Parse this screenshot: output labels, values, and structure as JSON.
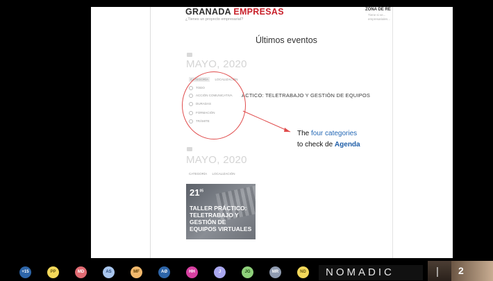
{
  "header": {
    "brand_part1": "GRANADA",
    "brand_part2": "EMPRESAS",
    "tagline": "¿Tienes un proyecto empresarial?",
    "zone_label": "ZONA DE RE",
    "zone_sub": "Tiene si ve... empresariales..."
  },
  "main": {
    "section_title": "Últimos eventos",
    "month1": "MAYO, 2020",
    "month2": "MAYO, 2020",
    "filters1": [
      "CATEGORÍA",
      "LOCALIZACIÓN"
    ],
    "filters2": [
      "CATEGORÍA",
      "LOCALIZACIÓN"
    ],
    "categories": [
      "TODO",
      "ACCIÓN COMUNICATIVA",
      "DURADAS",
      "FORMACIÓN",
      "TRÁMITE"
    ],
    "event_title": "ÁCTICO: TELETRABAJO Y GESTIÓN DE EQUIPOS",
    "card_date": "21",
    "card_date_sup": "05",
    "card_title": "TALLER PRÁCTICO: TELETRABAJO Y GESTIÓN DE EQUIPOS VIRTUALES"
  },
  "annotation": {
    "line1_pre": "The ",
    "line1_highlight": "four categories",
    "line2_pre": "to check de ",
    "line2_highlight": "Agenda",
    "circle_color": "#e04a4a",
    "highlight_color": "#2468b5"
  },
  "bottom_bar": {
    "participants": [
      "+15",
      "PP",
      "MD",
      "AS",
      "MF",
      "AØ",
      "HH",
      "J",
      "JG",
      "MR",
      "ND"
    ],
    "brand": "NOMADIC",
    "separator": "|",
    "page_number": "2"
  }
}
